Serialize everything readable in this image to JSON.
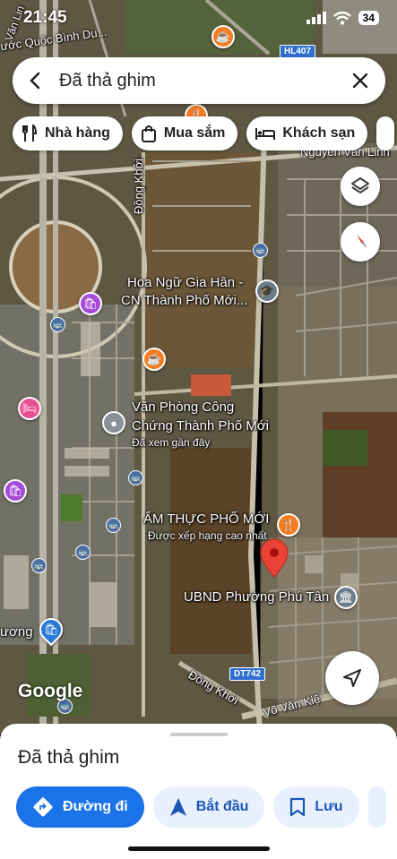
{
  "status": {
    "time": "21:45",
    "battery": "34"
  },
  "search": {
    "query": "Đã thả ghim"
  },
  "chips": [
    {
      "label": "Nhà hàng",
      "icon": "fork-knife-icon"
    },
    {
      "label": "Mua sắm",
      "icon": "shopping-bag-icon"
    },
    {
      "label": "Khách sạn",
      "icon": "bed-icon"
    }
  ],
  "map": {
    "labels": {
      "corner_street": "Văn Lin",
      "top_left": "ước Quốc Bình Du...",
      "nguyen_van_linh": "Nguyễn Văn Linh",
      "dong_khoi_vertical": "Đồng Khởi",
      "hoa_ngu_1": "Hoa Ngữ Gia Hân -",
      "hoa_ngu_2": "CN Thành Phố Mới...",
      "van_phong_1": "Văn Phòng Công",
      "van_phong_2": "Chứng Thành Phố Mới",
      "van_phong_sub": "Đã xem gần đây",
      "am_thuc": "ẨM THỰC PHỐ MỚI",
      "am_thuc_sub": "Được xếp hạng cao nhất",
      "ubnd": "UBND Phường Phú Tân",
      "phuong": "ương",
      "dong_khoi_diag": "Đồng Khởi",
      "vo_van_kiet": "Võ Văn Kiệ",
      "hl407": "HL407",
      "dt742": "DT742"
    }
  },
  "brand": "Google",
  "sheet": {
    "title": "Đã thả ghim",
    "actions": [
      {
        "label": "Đường đi",
        "style": "primary"
      },
      {
        "label": "Bắt đầu",
        "style": "tonal"
      },
      {
        "label": "Lưu",
        "style": "tonal"
      }
    ]
  },
  "colors": {
    "accent": "#1a73e8",
    "pin": "#ea4335"
  }
}
